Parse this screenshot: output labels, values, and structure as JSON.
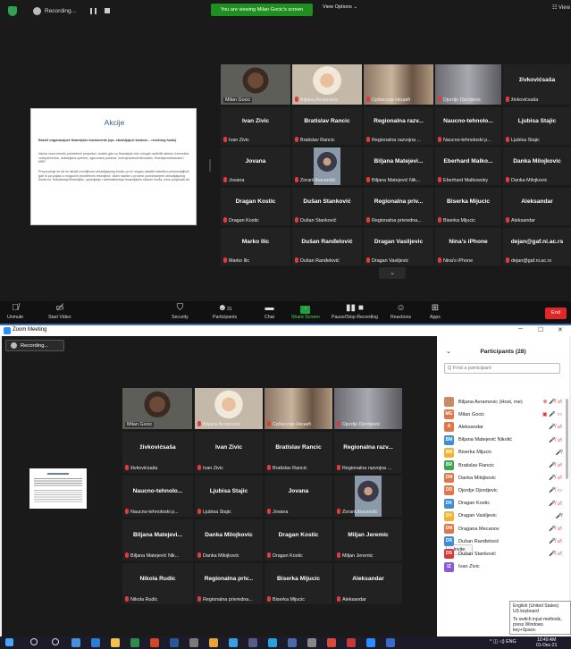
{
  "top": {
    "recording_label": "Recording...",
    "banner": "You are viewing Milan Gocic's screen",
    "view_options": "View Options ⌄",
    "view_button": "☷ View",
    "slide": {
      "title": "Akcije",
      "para1": "Razvili odgovarajuće finansijske instrumente (npr. obnavljajući fondove – revolving funds)",
      "para2": "Važna veza između prioritetnih preporka i svakih gde su finansijski više mnogih različitih aktera: komunika vodoprivredna, dobavljača opreme, ugovorača poslova, inženjera/izvornih/ostalo, finansijerna/banaka i MSP.",
      "para3": "Preporučuje se da se istraži izvodljivost obnavljajućeg fonda, pri te mogao ublažiti određivu prepoznatljivih gde bi pa pojavu u mogućim prioritetnim rešenjima. Važni stavke u procesi povezivanjem obnavljajućeg fonda su: finansiranje/finansijski, upravljanje i administriranje finansijskim rizikom fonda, izbor projekata itd."
    },
    "video_tiles": [
      {
        "label": "Milan Gocic"
      },
      {
        "label": "Biljana Avramovic"
      },
      {
        "label": "Србислав Нешић"
      },
      {
        "label": "Djordje Djordjevic"
      },
      {
        "name": "živkovićsaša",
        "label": "živkovićsaša"
      }
    ],
    "name_tiles": [
      {
        "name": "Ivan Zivic",
        "label": "Ivan Zivic"
      },
      {
        "name": "Bratislav Rancic",
        "label": "Bratislav Rancic"
      },
      {
        "name": "Regionalna razv...",
        "label": "Regionalna razvojna ..."
      },
      {
        "name": "Naucno-tehnolo...",
        "label": "Naucno-tehnoloski p..."
      },
      {
        "name": "Ljubisa Stajic",
        "label": "Ljubisa Stajic"
      },
      {
        "name": "Jovana",
        "label": "Jovana"
      },
      {
        "name": "",
        "label": "ZoranUbavandić"
      },
      {
        "name": "Biljana Matejevi...",
        "label": "Biljana Matejević Nik..."
      },
      {
        "name": "Eberhard Malko...",
        "label": "Eberhard Malkowsky"
      },
      {
        "name": "Danka Milojkovic",
        "label": "Danka Milojkovic"
      },
      {
        "name": "Dragan Kostic",
        "label": "Dragan Kostic"
      },
      {
        "name": "Dušan Stanković",
        "label": "Dušan Stanković"
      },
      {
        "name": "Regionalna priv...",
        "label": "Regionalna privredna..."
      },
      {
        "name": "Biserka Mijucic",
        "label": "Biserka Mijucic"
      },
      {
        "name": "Aleksandar",
        "label": "Aleksandar"
      },
      {
        "name": "Marko Ilic",
        "label": "Marko Ilic"
      },
      {
        "name": "Dušan Ranđelović",
        "label": "Dušan Ranđelović"
      },
      {
        "name": "Dragan Vasiljevic",
        "label": "Dragan Vasiljevic"
      },
      {
        "name": "Nina's iPhone",
        "label": "Nina's iPhone"
      },
      {
        "name": "dejan@gaf.ni.ac.rs",
        "label": "dejan@gaf.ni.ac.rs"
      }
    ],
    "toolbar": {
      "unmute": "Unmute",
      "start_video": "Start Video",
      "security": "Security",
      "participants": "Participants",
      "participants_count": "31",
      "chat": "Chat",
      "share_screen": "Share Screen",
      "pause_recording": "Pause/Stop Recording",
      "reactions": "Reactions",
      "apps": "Apps",
      "end": "End"
    }
  },
  "bottom": {
    "window_title": "Zoom Meeting",
    "recording_label": "Recording...",
    "video_tiles": [
      {
        "label": "Milan Gocic"
      },
      {
        "label": "Biljana Avramovic"
      },
      {
        "label": "Србислав Нешић"
      },
      {
        "label": "Djordje Djordjevic"
      }
    ],
    "name_tiles": [
      {
        "name": "živkovićsaša",
        "label": "živkovićsaša"
      },
      {
        "name": "Ivan Zivic",
        "label": "Ivan Zivic"
      },
      {
        "name": "Bratislav Rancic",
        "label": "Bratislav Rancic"
      },
      {
        "name": "Regionalna razv...",
        "label": "Regionalna razvojna ..."
      },
      {
        "name": "Naucno-tehnolo...",
        "label": "Naucno-tehnoloski p..."
      },
      {
        "name": "Ljubisa Stajic",
        "label": "Ljubisa Stajic"
      },
      {
        "name": "Jovana",
        "label": "Jovana"
      },
      {
        "name": "",
        "label": "ZoranUbavandić"
      },
      {
        "name": "Biljana Matejevi...",
        "label": "Biljana Matejević Nik..."
      },
      {
        "name": "Danka Milojkovic",
        "label": "Danka Milojkovic"
      },
      {
        "name": "Dragan Kostic",
        "label": "Dragan Kostic"
      },
      {
        "name": "Miljan Jeremic",
        "label": "Miljan Jeremic"
      },
      {
        "name": "Nikola Rudic",
        "label": "Nikola Rudic"
      },
      {
        "name": "Regionalna priv...",
        "label": "Regionalna privredna..."
      },
      {
        "name": "Biserka Mijucic",
        "label": "Biserka Mijucic"
      },
      {
        "name": "Aleksandar",
        "label": "Aleksandar"
      }
    ],
    "participants_panel": {
      "title": "Participants (28)",
      "search_placeholder": "Q Find a participant",
      "invite": "Invite",
      "rows": [
        {
          "initials": "",
          "name": "Biljana Avramovic (Host, me)",
          "color": "#c98a6a",
          "icons": "⊗ 🎤̸ ▭̸"
        },
        {
          "initials": "MG",
          "name": "Milan Gocic",
          "color": "#e0774a",
          "icons": "▣ 🎤 ▭"
        },
        {
          "initials": "A",
          "name": "Aleksandar",
          "color": "#e0774a",
          "icons": "🎤̸ ▭̸"
        },
        {
          "initials": "BM",
          "name": "Biljana Matejević Nikolić",
          "color": "#3a8fd6",
          "icons": "🎤̸ ▭̸"
        },
        {
          "initials": "BM",
          "name": "Biserka Mijucic",
          "color": "#f0b430",
          "icons": "🎤̸"
        },
        {
          "initials": "BR",
          "name": "Bratislav Rancic",
          "color": "#3aa655",
          "icons": "🎤̸ ▭̸"
        },
        {
          "initials": "DM",
          "name": "Danka Milojkovic",
          "color": "#e0774a",
          "icons": "🎤̸ ▭̸"
        },
        {
          "initials": "DD",
          "name": "Djordje Djordjevic",
          "color": "#e0774a",
          "icons": "🎤̸ ▭"
        },
        {
          "initials": "DK",
          "name": "Dragan Kostic",
          "color": "#3a8fd6",
          "icons": "🎤̸ ▭̸"
        },
        {
          "initials": "DV",
          "name": "Dragan Vasiljevic",
          "color": "#f0b430",
          "icons": "🎤̸"
        },
        {
          "initials": "DM",
          "name": "Dragana Mecanov",
          "color": "#e0774a",
          "icons": "🎤̸ ▭̸"
        },
        {
          "initials": "DR",
          "name": "Dušan Ranđelović",
          "color": "#3a8fd6",
          "icons": "🎤̸ ▭̸"
        },
        {
          "initials": "DS",
          "name": "Dušan Stanković",
          "color": "#d63a3a",
          "icons": "🎤̸ ▭̸"
        },
        {
          "initials": "IZ",
          "name": "Ivan Zivic",
          "color": "#8a5ad6",
          "icons": ""
        }
      ]
    },
    "tooltip": {
      "line1": "English (United States)",
      "line2": "US keyboard",
      "line3": "To switch input methods, press Windows key+Space."
    },
    "taskbar": {
      "lang": "ENG",
      "time": "10:49 AM",
      "date": "01-Dec-21"
    }
  },
  "colors": {
    "accent_green": "#1f8f1f",
    "end_red": "#e02828",
    "mic_muted": "#e03c3c",
    "speaker_outline": "#9ccc3d"
  }
}
